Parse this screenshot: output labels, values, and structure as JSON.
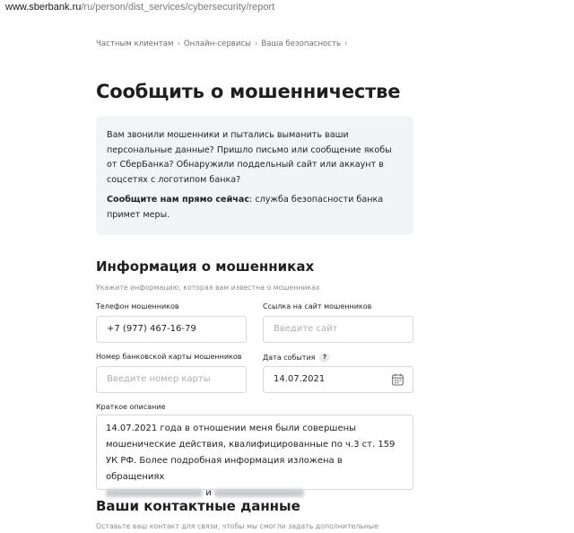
{
  "browser": {
    "url_host": "www.sberbank.ru",
    "url_path": "/ru/person/dist_services/cybersecurity/report"
  },
  "breadcrumb": [
    "Частным клиентам",
    "Онлайн-сервисы",
    "Ваша безопасность"
  ],
  "page_title": "Сообщить о мошенничестве",
  "info_box": {
    "paragraph1": "Вам звонили мошенники и пытались выманить ваши персональные данные? Пришло письмо или сообщение якобы от СберБанка? Обнаружили поддельный сайт или аккаунт в соцсетях с логотипом банка?",
    "paragraph2_bold": "Сообщите нам прямо сейчас",
    "paragraph2_rest": ": служба безопасности банка примет меры."
  },
  "fraud_section": {
    "title": "Информация о мошенниках",
    "hint": "Укажите информацию, которая вам известна о мошенниках",
    "phone_label": "Телефон мошенников",
    "phone_value": "+7 (977) 467-16-79",
    "site_label": "Ссылка на сайт мошенников",
    "site_placeholder": "Введите сайт",
    "card_label": "Номер банковской карты мошенников",
    "card_placeholder": "Введите номер карты",
    "date_label": "Дата события",
    "help_icon_glyph": "?",
    "date_value": "14.07.2021",
    "description_label": "Краткое описание",
    "description_text": "14.07.2021 года в отношении меня были совершены мошенические действия, квалифицированные по ч.3 ст. 159 УК РФ. Более подробная информация изложена в обращениях",
    "description_conjunction": "и"
  },
  "contact_section": {
    "title": "Ваши контактные данные",
    "hint": "Оставьте ваш контакт для связи, чтобы мы смогли задать дополнительные"
  }
}
